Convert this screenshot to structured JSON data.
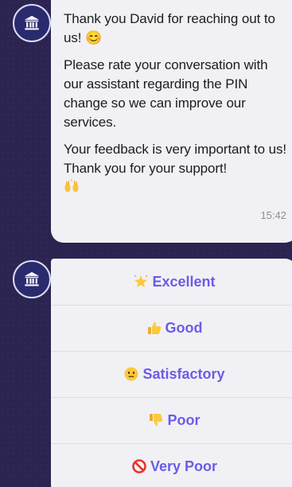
{
  "conversation": {
    "message": {
      "paragraphs": [
        "Thank you David for reaching out to us! 😊",
        "Please rate your conversation with our assistant regarding the PIN change so we can improve our services.",
        "Your feedback is very important to us! Thank you for your support!"
      ],
      "trailing_emoji_icon": "raising-hands-icon",
      "timestamp": "15:42"
    },
    "rating_options": [
      {
        "icon": "glowing-star-icon",
        "label": "Excellent"
      },
      {
        "icon": "thumbs-up-icon",
        "label": "Good"
      },
      {
        "icon": "neutral-face-icon",
        "label": "Satisfactory"
      },
      {
        "icon": "thumbs-down-icon",
        "label": "Poor"
      },
      {
        "icon": "prohibited-icon",
        "label": "Very Poor"
      }
    ],
    "bot_avatar_icon": "bank-icon"
  },
  "colors": {
    "background": "#2b2450",
    "bubble": "#f1f1f5",
    "option_text": "#6b5ce7",
    "avatar": "#2a2a6e"
  }
}
